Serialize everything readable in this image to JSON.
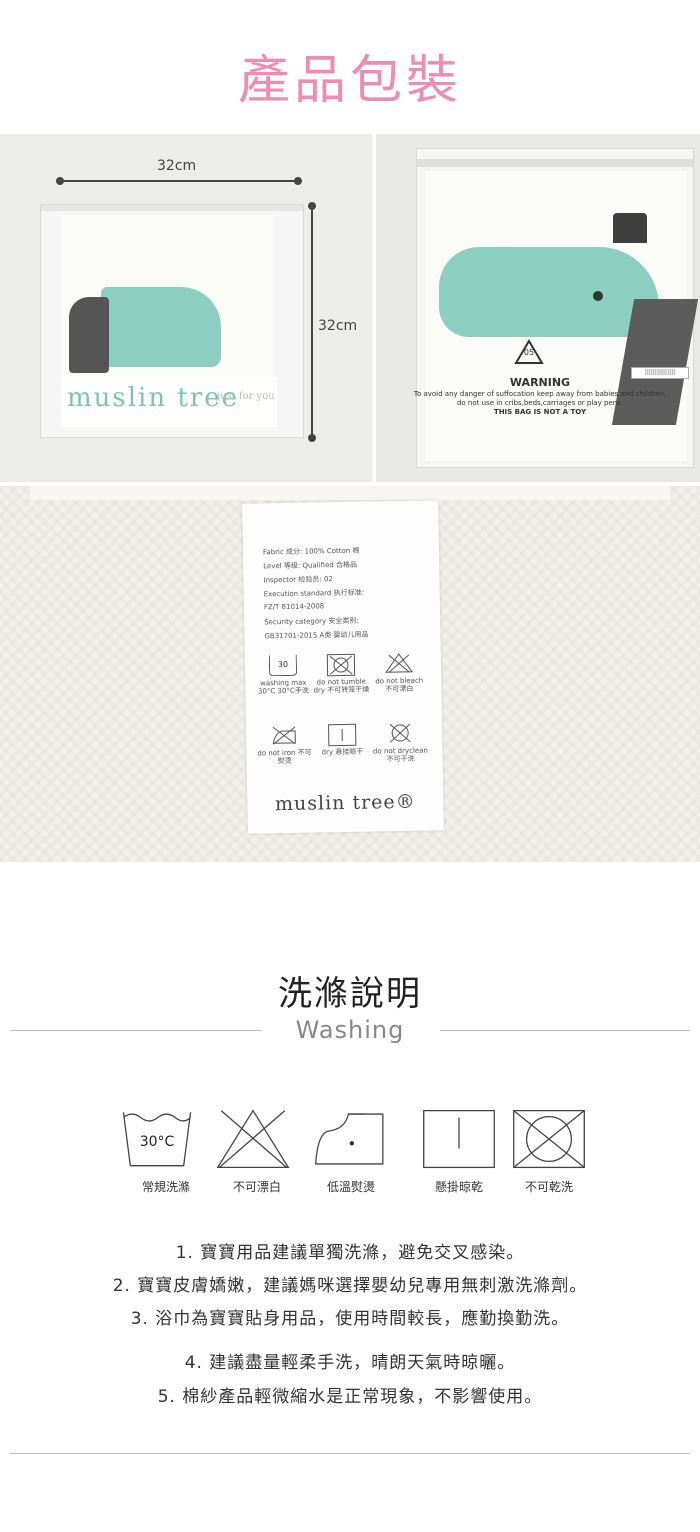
{
  "package_section": {
    "title": "產品包裝",
    "dim_width": "32cm",
    "dim_height": "32cm",
    "bag_brand": "muslin tree",
    "bag_tagline": "just for you",
    "warning": {
      "recycle_code": "05",
      "heading": "WARNING",
      "line1": "To avoid any danger of suffocation keep away from babies and children,",
      "line2": "do not use in cribs,beds,carriages or play pens.",
      "line3": "THIS BAG IS NOT A TOY"
    }
  },
  "care_label": {
    "lines": [
      "Fabric 成分: 100% Cotton 棉",
      "Level 等级: Qualified 合格品",
      "Inspector 检验员: 02",
      "Execution standard 执行标准:",
      "FZ/T 81014-2008",
      "Security category 安全类别:",
      "GB31701-2015 A类 婴幼儿用品"
    ],
    "icons_row1": [
      {
        "icon": "wash-30-icon",
        "caption": "washing max 30°C 30°C手洗",
        "value": "30"
      },
      {
        "icon": "no-tumble-dry-icon",
        "caption": "do not tumble dry 不可转笼干燥"
      },
      {
        "icon": "no-bleach-icon",
        "caption": "do not bleach 不可漂白"
      }
    ],
    "icons_row2": [
      {
        "icon": "no-iron-icon",
        "caption": "do not iron 不可熨烫"
      },
      {
        "icon": "line-dry-icon",
        "caption": "dry 悬挂晾干"
      },
      {
        "icon": "no-dryclean-icon",
        "caption": "do not dryclean 不可干洗"
      }
    ],
    "brand": "muslin tree®"
  },
  "washing_section": {
    "title": "洗滌說明",
    "subtitle": "Washing",
    "symbols": [
      {
        "icon": "hand-wash-30-icon",
        "label": "常規洗滌",
        "value": "30°C"
      },
      {
        "icon": "no-bleach-icon",
        "label": "不可漂白"
      },
      {
        "icon": "low-temp-iron-icon",
        "label": "低溫熨燙"
      },
      {
        "icon": "line-dry-icon",
        "label": "懸掛晾乾"
      },
      {
        "icon": "no-tumble-dry-icon",
        "label": "不可乾洗"
      }
    ],
    "notes": [
      "1. 寶寶用品建議單獨洗滌，避免交叉感染。",
      "2. 寶寶皮膚嬌嫩，建議媽咪選擇嬰幼兒專用無刺激洗滌劑。",
      "3. 浴巾為寶寶貼身用品，使用時間較長，應勤換勤洗。",
      "4. 建議盡量輕柔手洗，晴朗天氣時晾曬。",
      "5. 棉紗產品輕微縮水是正常現象，不影響使用。"
    ]
  },
  "colors": {
    "title_pink": "#f08cb0",
    "mint": "#8ccfc1",
    "text": "#333333"
  }
}
